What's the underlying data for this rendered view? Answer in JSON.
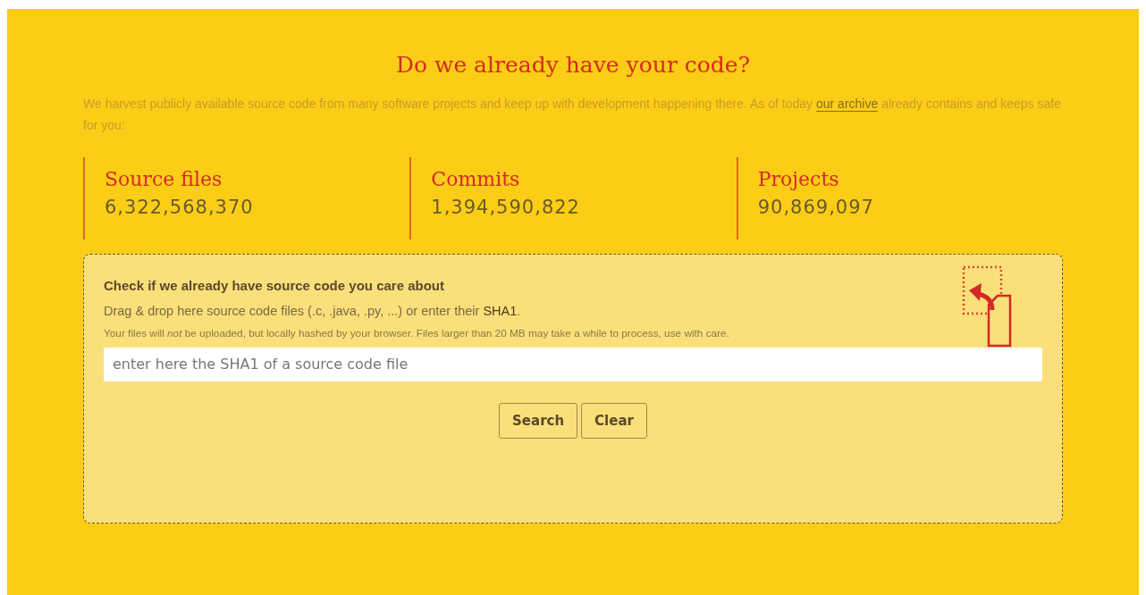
{
  "title": "Do we already have your code?",
  "intro": {
    "before": "We harvest publicly available source code from many software projects and keep up with development happening there. As of today",
    "link": "our archive",
    "after": "already contains and keeps safe for you:"
  },
  "stats": [
    {
      "label": "Source files",
      "value": "6,322,568,370"
    },
    {
      "label": "Commits",
      "value": "1,394,590,822"
    },
    {
      "label": "Projects",
      "value": "90,869,097"
    }
  ],
  "dropzone": {
    "heading": "Check if we already have source code you care about",
    "instructions": "Drag & drop here source code files (.c, .java, .py, ...) or enter their **SHA1**.",
    "note": "Your files will *not* be uploaded, but locally hashed by your browser. Files larger than 20 MB may take a while to process, use with care.",
    "placeholder": "enter here the SHA1 of a source code file",
    "buttons": [
      "Search",
      "Clear"
    ]
  }
}
